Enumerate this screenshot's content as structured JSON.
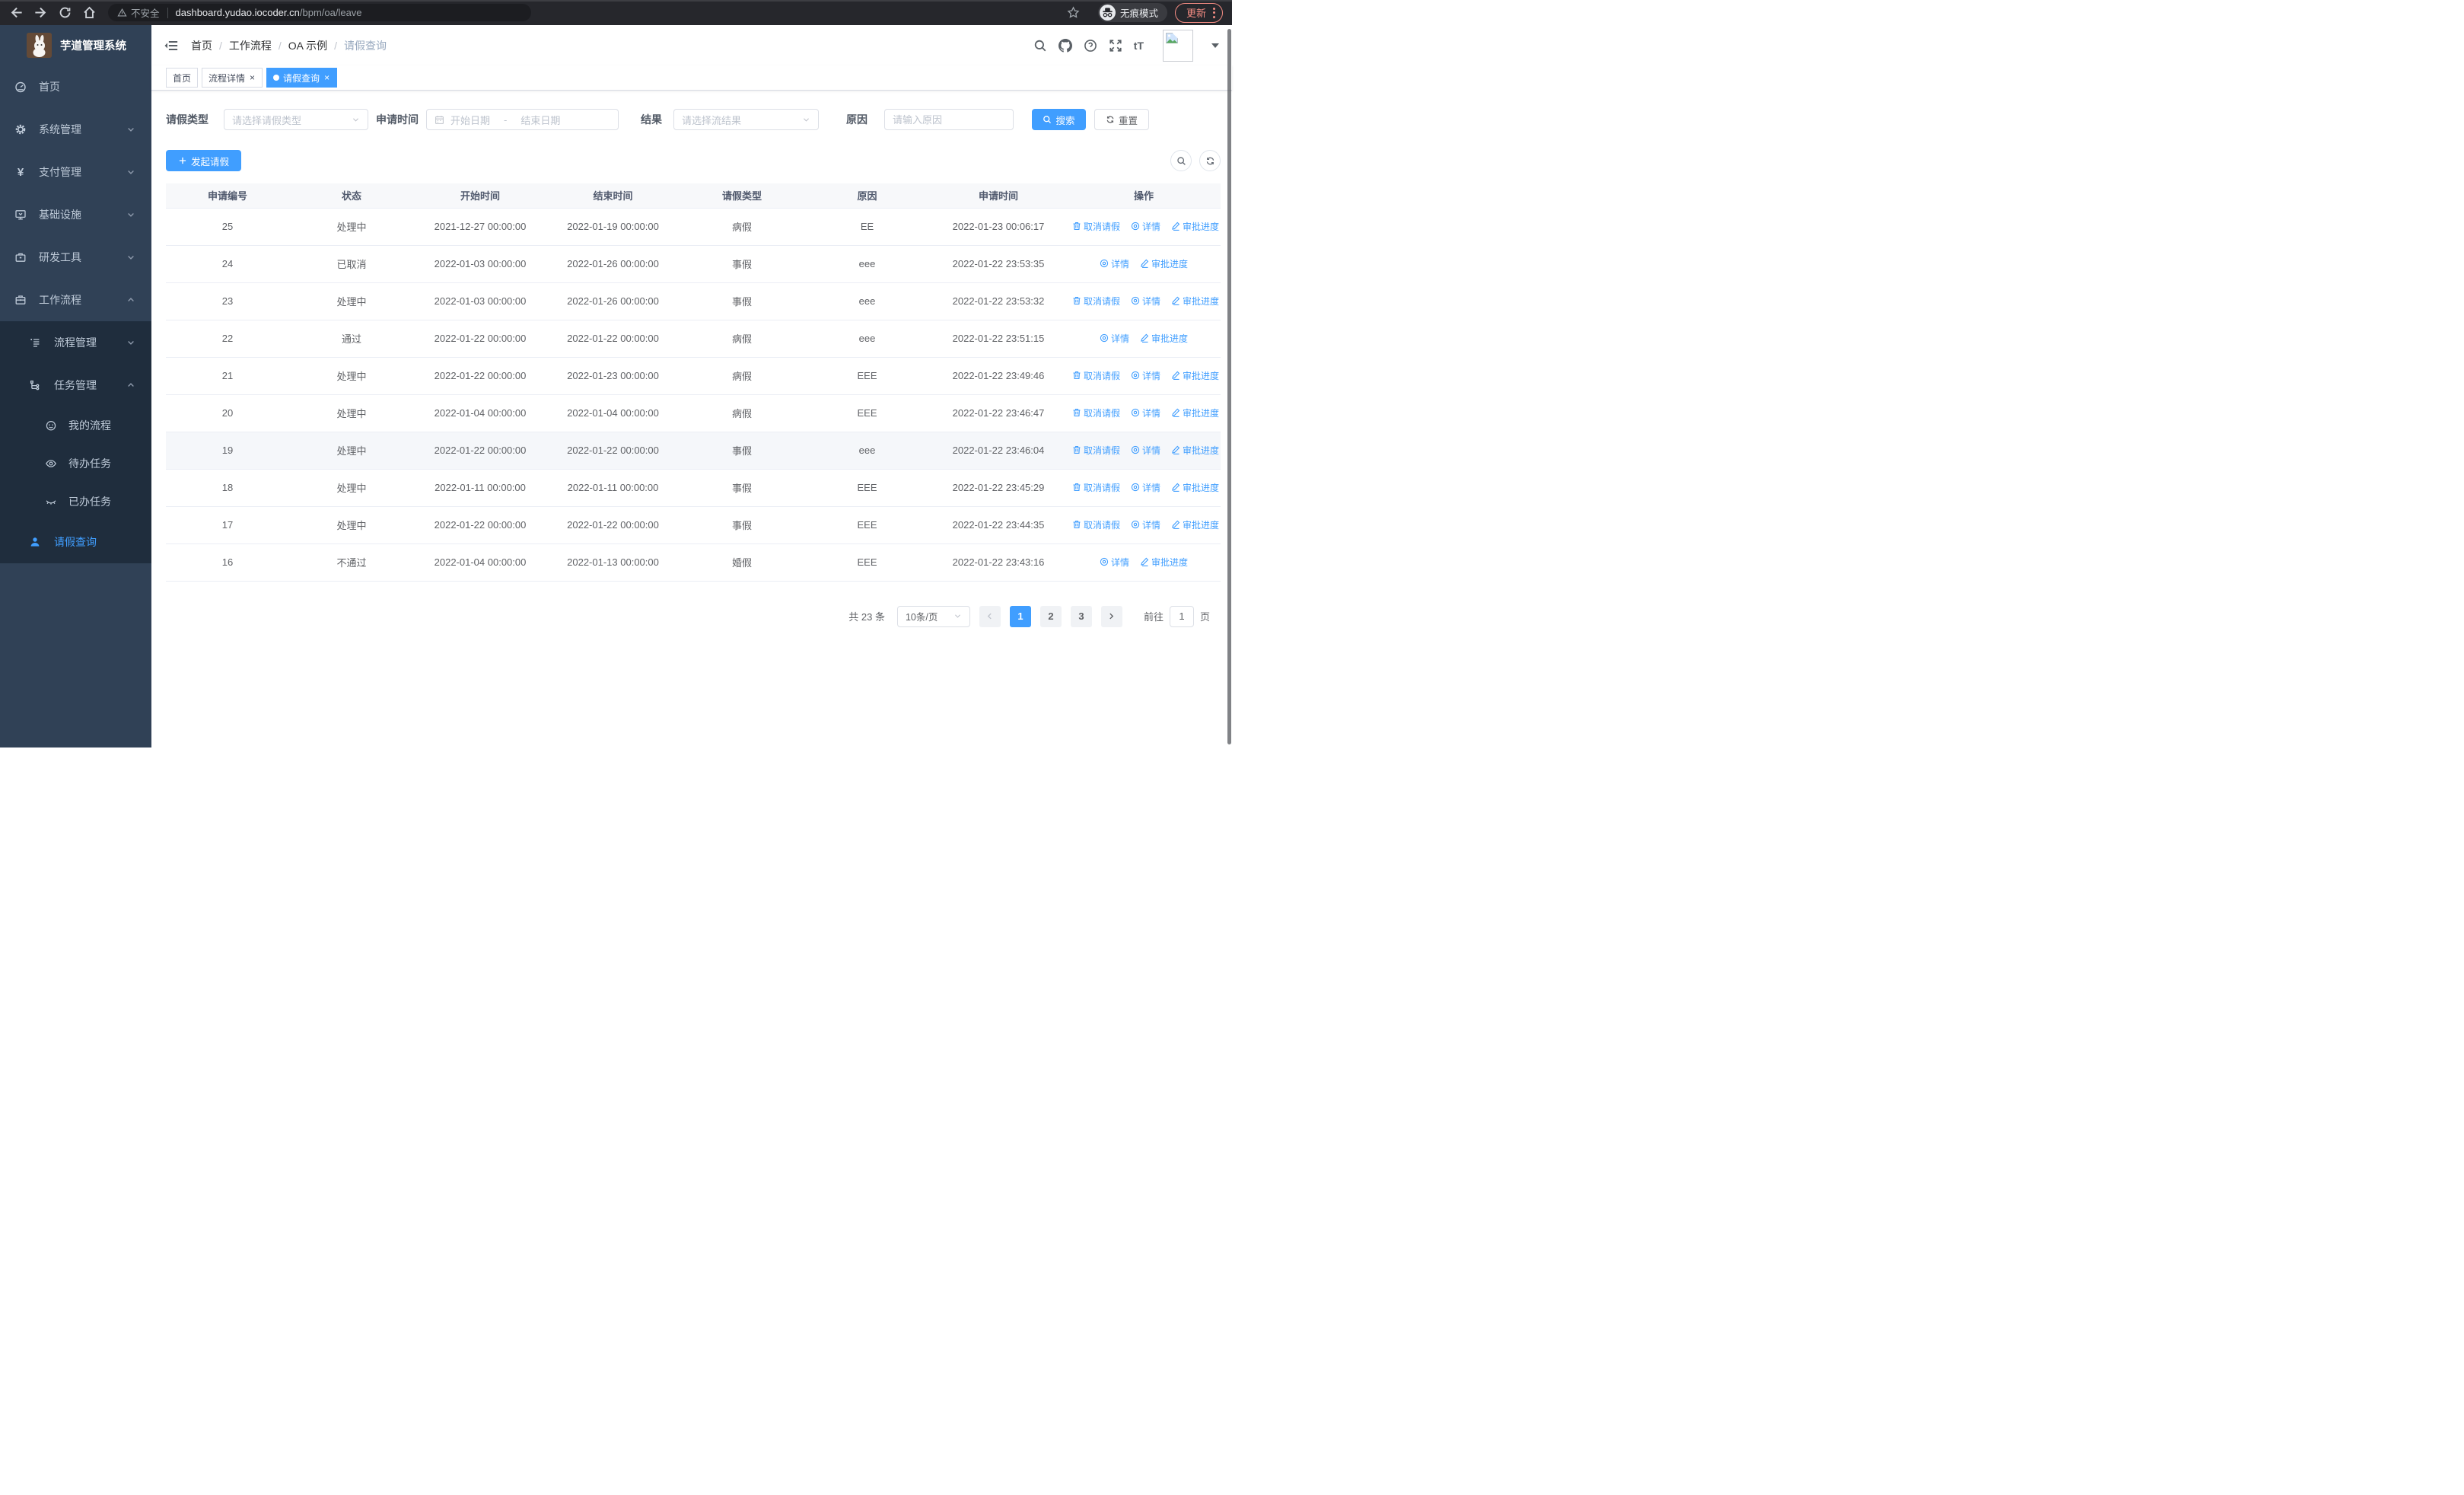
{
  "browser": {
    "security_label": "不安全",
    "url_host": "dashboard.yudao.iocoder.cn",
    "url_path": "/bpm/oa/leave",
    "incognito_label": "无痕模式",
    "update_label": "更新"
  },
  "colors": {
    "primary": "#409eff",
    "sidebar_bg": "#304156",
    "submenu_bg": "#1f2d3d",
    "update_accent": "#f28b82"
  },
  "sidebar": {
    "title": "芋道管理系统",
    "items": [
      {
        "label": "首页",
        "icon": "dashboard-icon"
      },
      {
        "label": "系统管理",
        "icon": "gear-icon",
        "chevron": "down"
      },
      {
        "label": "支付管理",
        "icon": "yen-icon",
        "chevron": "down"
      },
      {
        "label": "基础设施",
        "icon": "monitor-icon",
        "chevron": "down"
      },
      {
        "label": "研发工具",
        "icon": "toolbox-icon",
        "chevron": "down"
      },
      {
        "label": "工作流程",
        "icon": "briefcase-icon",
        "chevron": "up"
      }
    ],
    "submenu": [
      {
        "label": "流程管理",
        "icon": "list-icon",
        "chevron": "down"
      },
      {
        "label": "任务管理",
        "icon": "tree-icon",
        "chevron": "up"
      },
      {
        "label": "我的流程",
        "icon": "face-icon"
      },
      {
        "label": "待办任务",
        "icon": "eye-icon"
      },
      {
        "label": "已办任务",
        "icon": "eye-closed-icon"
      },
      {
        "label": "请假查询",
        "icon": "user-icon",
        "active": true
      }
    ]
  },
  "header": {
    "breadcrumb": [
      "首页",
      "工作流程",
      "OA 示例",
      "请假查询"
    ]
  },
  "tabs": [
    {
      "label": "首页",
      "closable": false,
      "active": false
    },
    {
      "label": "流程详情",
      "closable": true,
      "active": false
    },
    {
      "label": "请假查询",
      "closable": true,
      "active": true
    }
  ],
  "filters": {
    "type_label": "请假类型",
    "type_placeholder": "请选择请假类型",
    "time_label": "申请时间",
    "start_placeholder": "开始日期",
    "range_separator": "-",
    "end_placeholder": "结束日期",
    "result_label": "结果",
    "result_placeholder": "请选择流结果",
    "reason_label": "原因",
    "reason_placeholder": "请输入原因",
    "search_label": "搜索",
    "reset_label": "重置"
  },
  "toolbar": {
    "create_label": "发起请假"
  },
  "table": {
    "columns": [
      "申请编号",
      "状态",
      "开始时间",
      "结束时间",
      "请假类型",
      "原因",
      "申请时间",
      "操作"
    ],
    "action_labels": {
      "cancel": "取消请假",
      "detail": "详情",
      "progress": "审批进度"
    },
    "rows": [
      {
        "id": "25",
        "status": "处理中",
        "start": "2021-12-27 00:00:00",
        "end": "2022-01-19 00:00:00",
        "type": "病假",
        "reason": "EE",
        "apply_time": "2022-01-23 00:06:17",
        "actions": [
          "cancel",
          "detail",
          "progress"
        ],
        "highlight": false
      },
      {
        "id": "24",
        "status": "已取消",
        "start": "2022-01-03 00:00:00",
        "end": "2022-01-26 00:00:00",
        "type": "事假",
        "reason": "eee",
        "apply_time": "2022-01-22 23:53:35",
        "actions": [
          "detail",
          "progress"
        ],
        "highlight": false
      },
      {
        "id": "23",
        "status": "处理中",
        "start": "2022-01-03 00:00:00",
        "end": "2022-01-26 00:00:00",
        "type": "事假",
        "reason": "eee",
        "apply_time": "2022-01-22 23:53:32",
        "actions": [
          "cancel",
          "detail",
          "progress"
        ],
        "highlight": false
      },
      {
        "id": "22",
        "status": "通过",
        "start": "2022-01-22 00:00:00",
        "end": "2022-01-22 00:00:00",
        "type": "病假",
        "reason": "eee",
        "apply_time": "2022-01-22 23:51:15",
        "actions": [
          "detail",
          "progress"
        ],
        "highlight": false
      },
      {
        "id": "21",
        "status": "处理中",
        "start": "2022-01-22 00:00:00",
        "end": "2022-01-23 00:00:00",
        "type": "病假",
        "reason": "EEE",
        "apply_time": "2022-01-22 23:49:46",
        "actions": [
          "cancel",
          "detail",
          "progress"
        ],
        "highlight": false
      },
      {
        "id": "20",
        "status": "处理中",
        "start": "2022-01-04 00:00:00",
        "end": "2022-01-04 00:00:00",
        "type": "病假",
        "reason": "EEE",
        "apply_time": "2022-01-22 23:46:47",
        "actions": [
          "cancel",
          "detail",
          "progress"
        ],
        "highlight": false
      },
      {
        "id": "19",
        "status": "处理中",
        "start": "2022-01-22 00:00:00",
        "end": "2022-01-22 00:00:00",
        "type": "事假",
        "reason": "eee",
        "apply_time": "2022-01-22 23:46:04",
        "actions": [
          "cancel",
          "detail",
          "progress"
        ],
        "highlight": true
      },
      {
        "id": "18",
        "status": "处理中",
        "start": "2022-01-11 00:00:00",
        "end": "2022-01-11 00:00:00",
        "type": "事假",
        "reason": "EEE",
        "apply_time": "2022-01-22 23:45:29",
        "actions": [
          "cancel",
          "detail",
          "progress"
        ],
        "highlight": false
      },
      {
        "id": "17",
        "status": "处理中",
        "start": "2022-01-22 00:00:00",
        "end": "2022-01-22 00:00:00",
        "type": "事假",
        "reason": "EEE",
        "apply_time": "2022-01-22 23:44:35",
        "actions": [
          "cancel",
          "detail",
          "progress"
        ],
        "highlight": false
      },
      {
        "id": "16",
        "status": "不通过",
        "start": "2022-01-04 00:00:00",
        "end": "2022-01-13 00:00:00",
        "type": "婚假",
        "reason": "EEE",
        "apply_time": "2022-01-22 23:43:16",
        "actions": [
          "detail",
          "progress"
        ],
        "highlight": false
      }
    ]
  },
  "pagination": {
    "total": "共 23 条",
    "page_size": "10条/页",
    "pages": [
      "1",
      "2",
      "3"
    ],
    "active_page": "1",
    "goto_label": "前往",
    "goto_value": "1",
    "goto_suffix": "页"
  }
}
